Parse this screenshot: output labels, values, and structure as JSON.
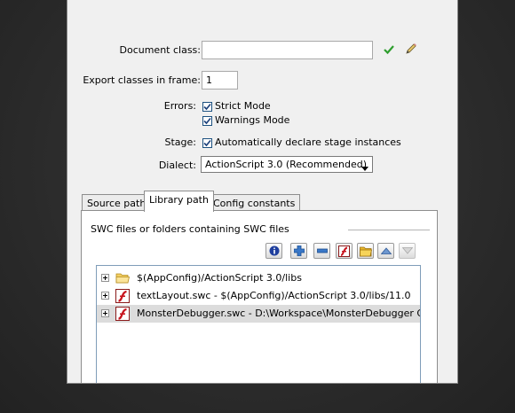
{
  "form": {
    "document_class_label": "Document class:",
    "document_class_value": "",
    "export_frame_label": "Export classes in frame:",
    "export_frame_value": "1",
    "errors_label": "Errors:",
    "strict_mode_label": "Strict Mode",
    "strict_mode_checked": true,
    "warnings_mode_label": "Warnings Mode",
    "warnings_mode_checked": true,
    "stage_label": "Stage:",
    "auto_declare_label": "Automatically declare stage instances",
    "auto_declare_checked": true,
    "dialect_label": "Dialect:",
    "dialect_value": "ActionScript 3.0 (Recommended)"
  },
  "tabs": [
    {
      "label": "Source path",
      "active": false
    },
    {
      "label": "Library path",
      "active": true
    },
    {
      "label": "Config constants",
      "active": false
    }
  ],
  "library": {
    "group_label": "SWC files or folders containing SWC files",
    "toolbar_icons": [
      "info-icon",
      "add-icon",
      "remove-icon",
      "flash-swc-icon",
      "folder-icon",
      "move-up-icon",
      "move-down-icon"
    ],
    "items": [
      {
        "icon": "folder-icon",
        "text": "$(AppConfig)/ActionScript 3.0/libs",
        "selected": false
      },
      {
        "icon": "flash-swc-icon",
        "text": "textLayout.swc - $(AppConfig)/ActionScript 3.0/libs/11.0",
        "selected": false
      },
      {
        "icon": "flash-swc-icon",
        "text": "MonsterDebugger.swc - D:\\Workspace\\MonsterDebugger Game\\libs",
        "selected": true
      }
    ]
  },
  "colors": {
    "checkmark_green": "#2e9e2e",
    "flash_red": "#c8141e",
    "info_blue": "#1f3f9e",
    "selection_gray": "#dcdcdc"
  }
}
